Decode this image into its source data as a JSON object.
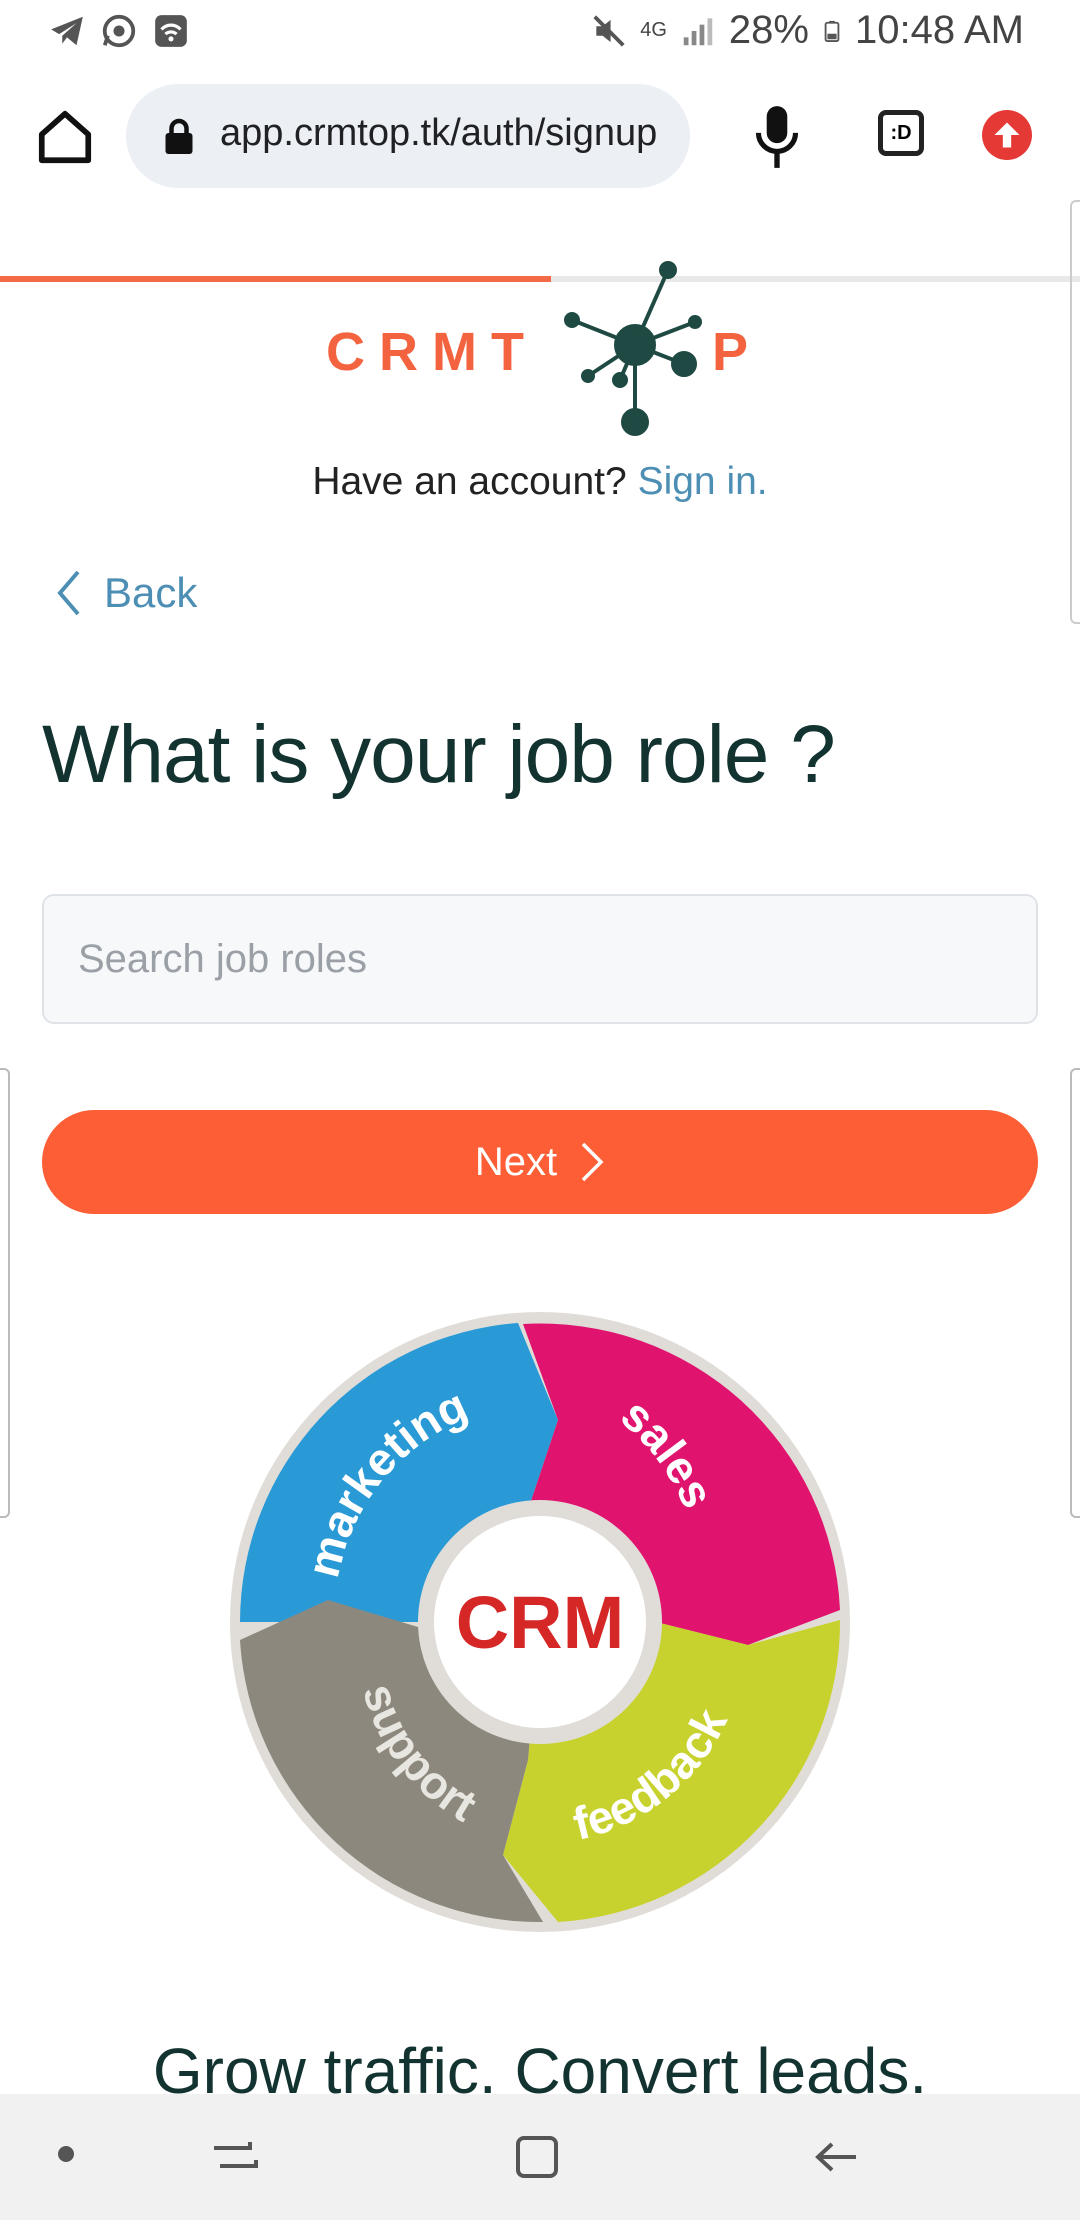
{
  "status_bar": {
    "battery": "28%",
    "time": "10:48 AM",
    "network": "4G"
  },
  "browser": {
    "url": "app.crmtop.tk/auth/signup",
    "tab_button_label": ":D",
    "page_progress": 0.51
  },
  "logo": {
    "text_left": "CRMT",
    "text_right": "P"
  },
  "account": {
    "prompt": "Have an account?",
    "link": "Sign in."
  },
  "back_label": "Back",
  "heading": "What is your job role ?",
  "search": {
    "placeholder": "Search job roles",
    "value": ""
  },
  "next_label": "Next",
  "crm_wheel": {
    "center": "CRM",
    "segments": [
      "marketing",
      "sales",
      "feedback",
      "support"
    ]
  },
  "tagline": "Grow traffic. Convert leads.",
  "colors": {
    "accent": "#fe5e35",
    "link": "#4d8fb4",
    "heading": "#123330",
    "marketing": "#2a9ad7",
    "sales": "#e0136e",
    "feedback": "#c8d22e",
    "support": "#8d887d",
    "crm_text": "#d62727"
  }
}
